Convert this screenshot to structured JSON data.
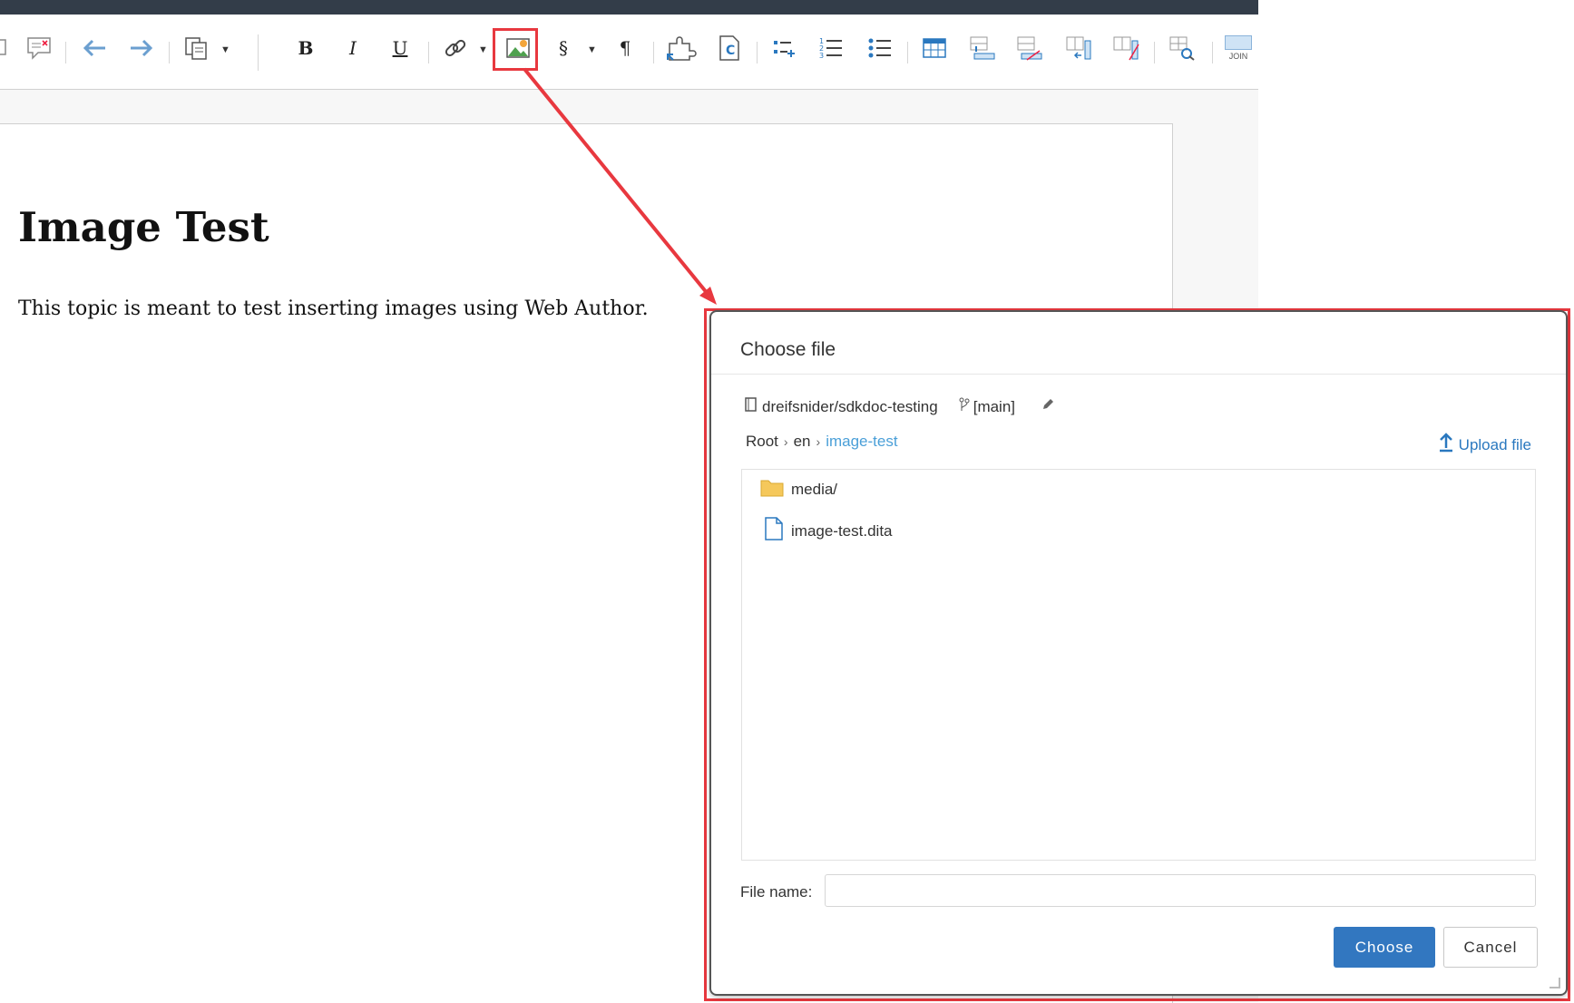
{
  "toolbar": {
    "icons": [
      "comment-delete",
      "undo",
      "redo",
      "paste",
      "bold",
      "italic",
      "underline",
      "link",
      "image",
      "section",
      "paragraph",
      "insert-conref",
      "insert-content",
      "list-item",
      "ordered-list",
      "unordered-list",
      "table",
      "table-row-insert",
      "table-row-delete",
      "table-col-insert",
      "table-col-delete",
      "table-properties",
      "join-cells"
    ],
    "bold_label": "B",
    "italic_label": "I",
    "underline_label": "U",
    "section_label": "§",
    "paragraph_label": "¶",
    "join_label": "JOIN",
    "highlight_color": "#e8383f"
  },
  "document": {
    "title": "Image Test",
    "paragraph": "This topic is meant to test inserting images using Web Author."
  },
  "dialog": {
    "title": "Choose file",
    "repo": "dreifsnider/sdkdoc-testing",
    "branch": "[main]",
    "breadcrumbs": [
      "Root",
      "en",
      "image-test"
    ],
    "upload_label": "Upload file",
    "files": [
      {
        "name": "media/",
        "type": "folder"
      },
      {
        "name": "image-test.dita",
        "type": "file"
      }
    ],
    "file_name_label": "File name:",
    "file_name_value": "",
    "choose_label": "Choose",
    "cancel_label": "Cancel"
  },
  "colors": {
    "accent": "#3277c0",
    "annotation": "#e8383f",
    "topbar": "#333d49"
  }
}
